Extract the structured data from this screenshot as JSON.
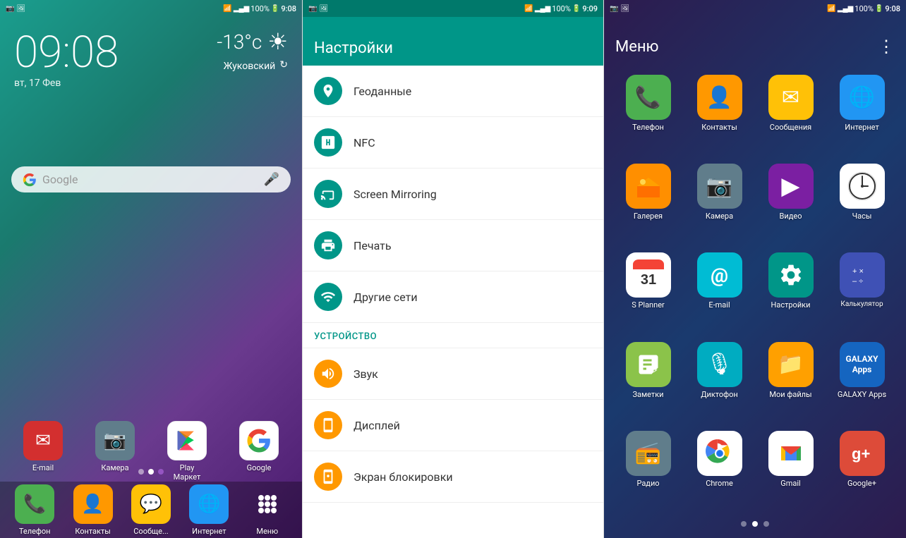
{
  "home": {
    "status_bar": {
      "time": "9:08",
      "battery": "100%",
      "signal": "▲▼",
      "wifi": "WiFi"
    },
    "clock": {
      "time": "09:08",
      "date": "вт, 17 Фев"
    },
    "weather": {
      "temp": "-13°c",
      "city": "Жуковский",
      "icon": "☀"
    },
    "search": {
      "placeholder": "Google",
      "mic_icon": "mic"
    },
    "apps": [
      {
        "label": "E-mail",
        "icon": "✉",
        "bg": "red"
      },
      {
        "label": "Камера",
        "icon": "📷",
        "bg": "gray"
      },
      {
        "label": "Play\nМаркет",
        "icon": "▶",
        "bg": "white"
      },
      {
        "label": "Google",
        "icon": "G",
        "bg": "white"
      }
    ],
    "dock": [
      {
        "label": "Телефон",
        "icon": "📞",
        "bg": "green"
      },
      {
        "label": "Контакты",
        "icon": "👤",
        "bg": "orange"
      },
      {
        "label": "Сообще...",
        "icon": "✉",
        "bg": "yellow"
      },
      {
        "label": "Интернет",
        "icon": "🌐",
        "bg": "blue"
      },
      {
        "label": "Меню",
        "icon": "⋮⋮⋮",
        "bg": "transparent"
      }
    ]
  },
  "settings": {
    "header": "Настройки",
    "status_bar": {
      "time": "9:09",
      "battery": "100%"
    },
    "items": [
      {
        "label": "Геоданные",
        "icon": "📍",
        "color": "teal"
      },
      {
        "label": "NFC",
        "icon": "📶",
        "color": "teal"
      },
      {
        "label": "Screen Mirroring",
        "icon": "📺",
        "color": "teal"
      },
      {
        "label": "Печать",
        "icon": "🖨",
        "color": "teal"
      },
      {
        "label": "Другие сети",
        "icon": "📡",
        "color": "teal"
      }
    ],
    "section_device": "УСТРОЙСТВО",
    "device_items": [
      {
        "label": "Звук",
        "icon": "🔊",
        "color": "orange"
      },
      {
        "label": "Дисплей",
        "icon": "📱",
        "color": "orange"
      },
      {
        "label": "Экран блокировки",
        "icon": "🔒",
        "color": "orange"
      }
    ]
  },
  "menu": {
    "title": "Меню",
    "status_bar": {
      "time": "9:08",
      "battery": "100%"
    },
    "apps": [
      {
        "label": "Телефон",
        "icon": "📞",
        "bg": "green"
      },
      {
        "label": "Контакты",
        "icon": "👤",
        "bg": "orange"
      },
      {
        "label": "Сообщения",
        "icon": "✉",
        "bg": "yellow"
      },
      {
        "label": "Интернет",
        "icon": "🌐",
        "bg": "blue"
      },
      {
        "label": "Галерея",
        "icon": "🖼",
        "bg": "amber"
      },
      {
        "label": "Камера",
        "icon": "📷",
        "bg": "gray"
      },
      {
        "label": "Видео",
        "icon": "▶",
        "bg": "purple"
      },
      {
        "label": "Часы",
        "icon": "🕐",
        "bg": "white"
      },
      {
        "label": "S Planner",
        "icon": "31",
        "bg": "white"
      },
      {
        "label": "E-mail",
        "icon": "@",
        "bg": "cyan"
      },
      {
        "label": "Настройки",
        "icon": "⚙",
        "bg": "teal"
      },
      {
        "label": "Калькулятор",
        "icon": "÷",
        "bg": "indigo"
      },
      {
        "label": "Заметки",
        "icon": "📝",
        "bg": "green"
      },
      {
        "label": "Диктофон",
        "icon": "🎙",
        "bg": "cyan"
      },
      {
        "label": "Мои файлы",
        "icon": "📁",
        "bg": "amber"
      },
      {
        "label": "GALAXY Apps",
        "icon": "G",
        "bg": "dark_blue"
      },
      {
        "label": "Радио",
        "icon": "📻",
        "bg": "gray"
      },
      {
        "label": "Chrome",
        "icon": "◎",
        "bg": "white"
      },
      {
        "label": "Gmail",
        "icon": "M",
        "bg": "red"
      },
      {
        "label": "Google+",
        "icon": "g+",
        "bg": "red_dark"
      }
    ],
    "dots": [
      false,
      true,
      false
    ],
    "more_icon": "⋮"
  }
}
